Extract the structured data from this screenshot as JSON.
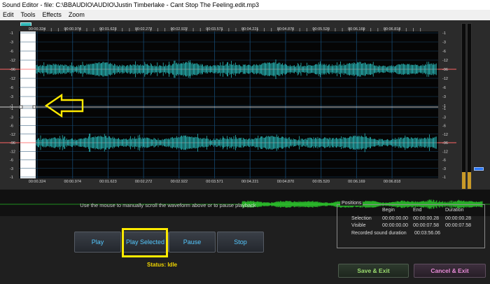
{
  "window": {
    "title": "Sound Editor - file: C:\\BBAUDIO\\AUDIO\\Justin Timberlake - Cant Stop The Feeling.edit.mp3"
  },
  "menu": [
    "Edit",
    "Tools",
    "Effects",
    "Zoom"
  ],
  "timeline": {
    "labels": [
      "00:00.324",
      "00:00.974",
      "00:01.623",
      "00:02.272",
      "00:02.922",
      "00:03.571",
      "00:04.221",
      "00:04.870",
      "00:05.520",
      "00:06.169",
      "00:06.818"
    ]
  },
  "db_scale": [
    "-1",
    "-3",
    "-6",
    "-12",
    "-96",
    "-12",
    "-6",
    "-3",
    "-1"
  ],
  "colors": {
    "waveform": "#2ed1d1",
    "overview": "#2fd22f",
    "accent": "#54c8ff",
    "highlight": "#ffea00"
  },
  "instructions": {
    "hint": "Use the mouse to manually scroll the waveform above or to pause playback"
  },
  "buttons": {
    "play": "Play",
    "play_selected": "Play Selected",
    "pause": "Pause",
    "stop": "Stop"
  },
  "status": "Status: Idle",
  "positions": {
    "title": "Positions",
    "headers": {
      "begin": "Begin",
      "end": "End",
      "duration": "Duration"
    },
    "selection": {
      "label": "Selection",
      "begin": "00:00:00.00",
      "end": "00:00:00.28",
      "duration": "00:00:00.28"
    },
    "visible": {
      "label": "Visible",
      "begin": "00:00:00.00",
      "end": "00:00:07.58",
      "duration": "00:00:07.58"
    },
    "recorded": {
      "label": "Recorded sound duration",
      "value": "00:03:56.06"
    }
  },
  "actions": {
    "save_exit": "Save & Exit",
    "cancel_exit": "Cancel & Exit"
  },
  "levels": {
    "left": 0.1,
    "right": 0.1
  }
}
